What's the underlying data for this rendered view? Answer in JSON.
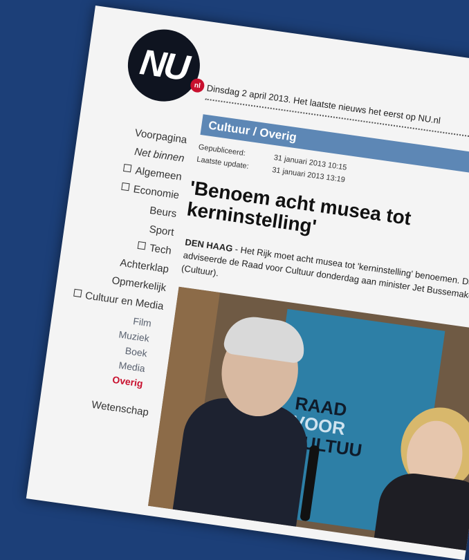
{
  "site": {
    "logo_text": "NU",
    "logo_badge": "nl"
  },
  "dateline": "Dinsdag 2 april 2013. Het laatste nieuws het eerst op NU.nl",
  "nav": {
    "items": [
      {
        "label": "Voorpagina"
      },
      {
        "label": "Net binnen"
      },
      {
        "label": "Algemeen"
      },
      {
        "label": "Economie"
      },
      {
        "label": "Beurs"
      },
      {
        "label": "Sport"
      },
      {
        "label": "Tech"
      },
      {
        "label": "Achterklap"
      },
      {
        "label": "Opmerkelijk"
      },
      {
        "label": "Cultuur en Media"
      }
    ],
    "sub_items": [
      {
        "label": "Film"
      },
      {
        "label": "Muziek"
      },
      {
        "label": "Boek"
      },
      {
        "label": "Media"
      },
      {
        "label": "Overig"
      }
    ],
    "wetenschap": "Wetenschap"
  },
  "article": {
    "section": "Cultuur / Overig",
    "published_label": "Gepubliceerd:",
    "published_value": "31 januari 2013 10:15",
    "updated_label": "Laatste update:",
    "updated_value": "31 januari 2013 13:19",
    "headline": "'Benoem acht musea tot kerninstelling'",
    "lead_location": "DEN HAAG",
    "lead_text": " - Het Rijk moet acht musea tot 'kerninstelling' benoemen. Dat adviseerde de Raad voor Cultuur donderdag aan minister Jet Bussemaker (Cultuur).",
    "photo": {
      "poster_line1": "RAAD",
      "poster_line2": "VOOR",
      "poster_line3": "CULTUU"
    }
  }
}
